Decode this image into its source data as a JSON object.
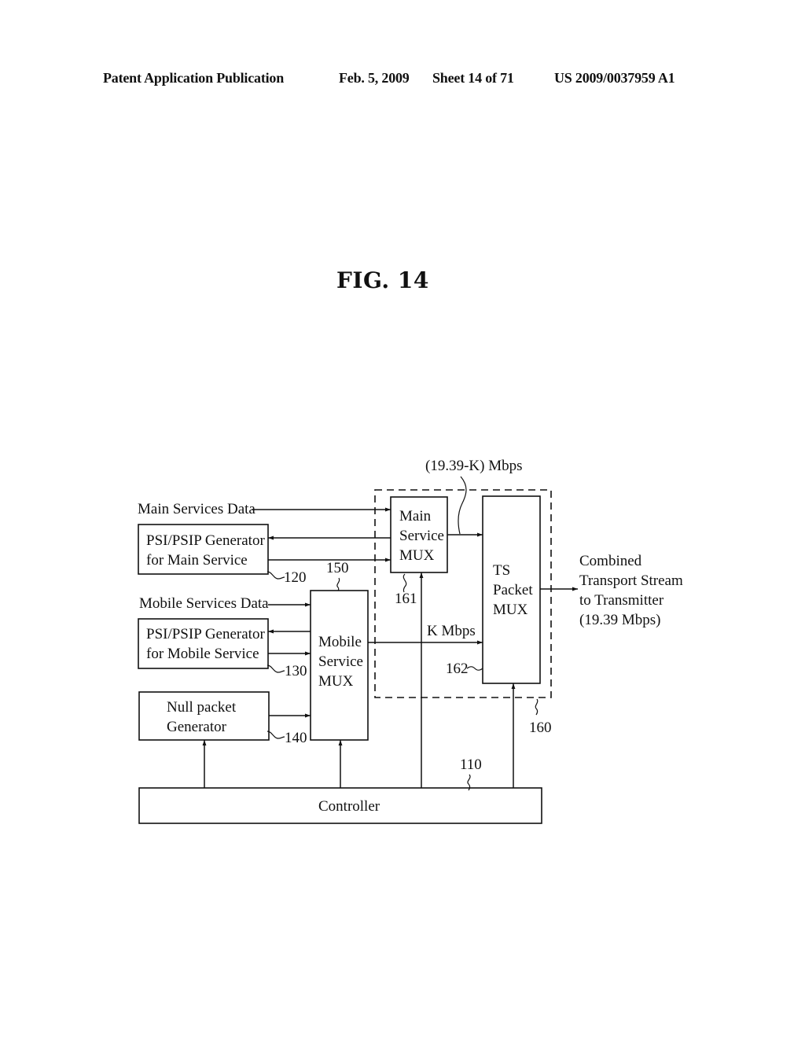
{
  "header": {
    "publication": "Patent Application Publication",
    "date": "Feb. 5, 2009",
    "sheet": "Sheet 14 of 71",
    "patent_number": "US 2009/0037959 A1"
  },
  "figure": {
    "title": "FIG. 14"
  },
  "diagram": {
    "inputs": {
      "main_services_data": "Main Services Data",
      "mobile_services_data": "Mobile Services Data"
    },
    "blocks": {
      "psi_main": {
        "line1": "PSI/PSIP Generator",
        "line2": "for Main Service",
        "ref": "120"
      },
      "psi_mobile": {
        "line1": "PSI/PSIP Generator",
        "line2": "for Mobile Service",
        "ref": "130"
      },
      "null_packet": {
        "line1": "Null packet",
        "line2": "Generator",
        "ref": "140"
      },
      "mobile_mux": {
        "line1": "Mobile",
        "line2": "Service",
        "line3": "MUX",
        "ref": "150"
      },
      "main_mux": {
        "line1": "Main",
        "line2": "Service",
        "line3": "MUX",
        "ref": "161"
      },
      "ts_mux": {
        "line1": "TS",
        "line2": "Packet",
        "line3": "MUX",
        "ref": "162"
      },
      "controller": {
        "label": "Controller",
        "ref": "110"
      },
      "multiplexer_group": {
        "ref": "160"
      }
    },
    "rates": {
      "main_rate": "(19.39-K) Mbps",
      "mobile_rate": "K Mbps"
    },
    "output": {
      "line1": "Combined",
      "line2": "Transport Stream",
      "line3": "to Transmitter",
      "line4": "(19.39 Mbps)"
    }
  }
}
